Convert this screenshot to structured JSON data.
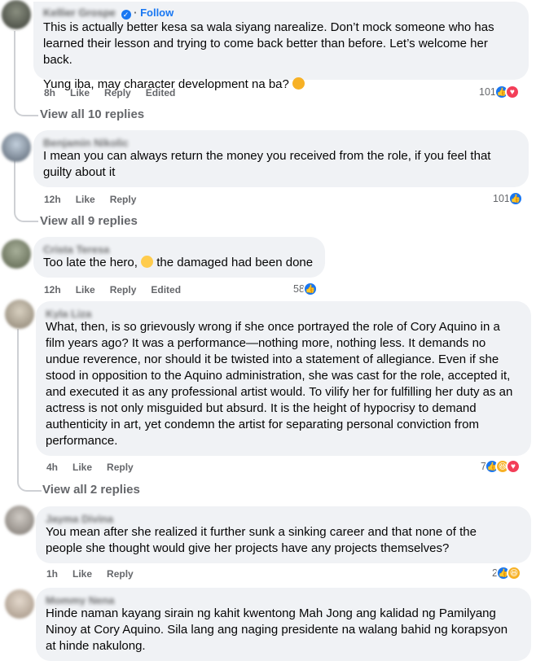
{
  "comments": [
    {
      "author": "Kellier Grospe",
      "follow_label": "Follow",
      "paragraphs": [
        "This is actually better kesa sa wala siyang narealize. Don’t mock someone who has learned their lesson and trying to come back better than before. Let’s welcome her back.",
        "Yung iba, may character development na ba?"
      ],
      "time": "8h",
      "like": "Like",
      "reply": "Reply",
      "edited": "Edited",
      "reaction_count": "101",
      "view_replies": "View all 10 replies"
    },
    {
      "author": "Benjamin Nikolic",
      "paragraphs": [
        "I mean you can always return the money you received from the role, if you feel that guilty about it"
      ],
      "time": "12h",
      "like": "Like",
      "reply": "Reply",
      "reaction_count": "101",
      "view_replies": "View all 9 replies"
    },
    {
      "author": "Crista Teresa",
      "paragraphs_a": "Too late the hero,",
      "paragraphs_b": "the damaged had been done",
      "time": "12h",
      "like": "Like",
      "reply": "Reply",
      "edited": "Edited",
      "reaction_count": "58"
    },
    {
      "author": "Kyla Liza",
      "paragraphs": [
        "What, then, is so grievously wrong if she once portrayed the role of Cory Aquino in a film years ago? It was a performance—nothing more, nothing less. It demands no undue reverence, nor should it be twisted into a statement of allegiance. Even if she stood in opposition to the Aquino administration, she was cast for the role, accepted it, and executed it as any professional artist would. To vilify her for fulfilling her duty as an actress is not only misguided but absurd. It is the height of hypocrisy to demand authenticity in art, yet condemn the artist for separating personal conviction from performance."
      ],
      "time": "4h",
      "like": "Like",
      "reply": "Reply",
      "reaction_count": "7",
      "view_replies": "View all 2 replies"
    },
    {
      "author": "Jayma Divina",
      "paragraphs": [
        "You mean after she realized it further sunk a sinking career and that none of the people she thought would give her projects have any projects themselves?"
      ],
      "time": "1h",
      "like": "Like",
      "reply": "Reply",
      "reaction_count": "2"
    },
    {
      "author": "Mommy Nena",
      "paragraphs": [
        "Hinde naman kayang sirain ng kahit kwentong Mah Jong ang kalidad ng Pamilyang Ninoy at Cory Aquino. Sila lang ang naging presidente na walang bahid ng korapsyon at hinde nakulong."
      ]
    }
  ],
  "colors": {
    "bubble": "#f0f2f5",
    "secondary_text": "#65676b",
    "link_blue": "#1877f2",
    "like": "#1877f2",
    "love": "#f33e58",
    "haha": "#f7b125"
  },
  "icons": [
    "like-icon",
    "love-icon",
    "haha-icon",
    "verified-badge-icon",
    "grimace-emoji-icon",
    "blush-emoji-icon"
  ]
}
